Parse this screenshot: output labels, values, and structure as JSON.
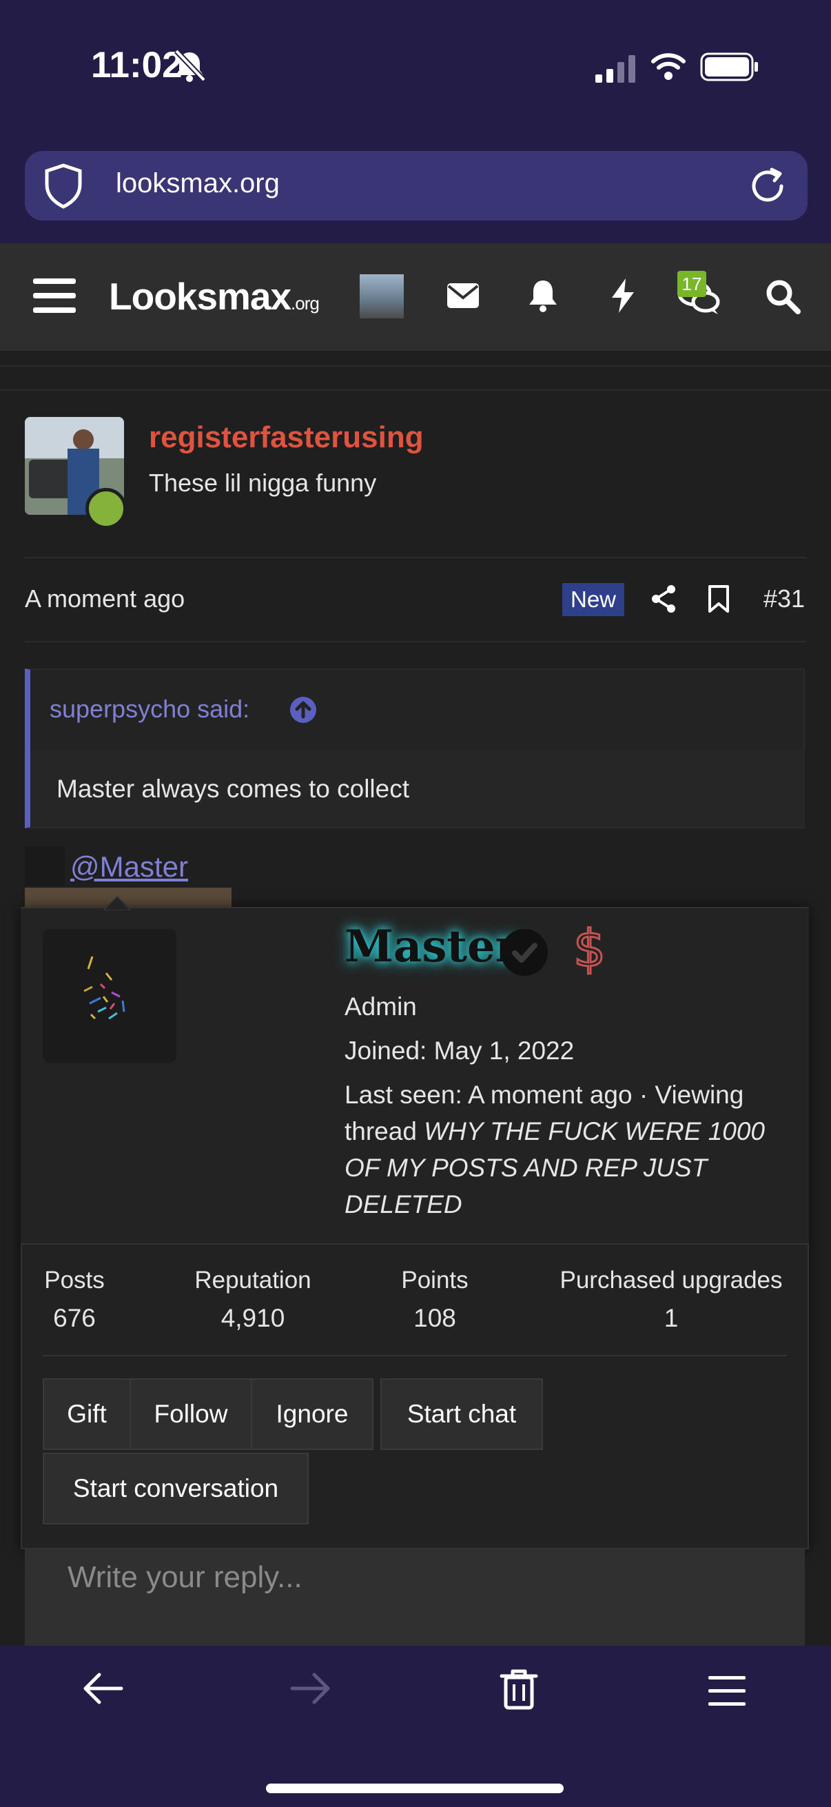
{
  "status_bar": {
    "time": "11:02"
  },
  "browser": {
    "url": "looksmax.org"
  },
  "forum_nav": {
    "logo_main": "Looksmax",
    "logo_suffix": ".org",
    "chat_badge_count": "17"
  },
  "post": {
    "username": "registerfasterusing",
    "user_title": "These lil nigga funny",
    "time": "A moment ago",
    "new_badge": "New",
    "post_number": "#31",
    "quote": {
      "author": "superpsycho said:",
      "text": "Master always comes to collect"
    },
    "mention": "@Master"
  },
  "member_card": {
    "name": "Master",
    "role": "Admin",
    "joined": "Joined: May 1, 2022",
    "last_seen_prefix": "Last seen: A moment ago · Viewing",
    "last_seen_line2_prefix": "thread ",
    "last_seen_line2_thread": "WHY THE FUCK WERE 1000",
    "last_seen_line3": "OF MY POSTS AND REP JUST",
    "last_seen_line4": "DELETED",
    "stats": [
      {
        "label": "Posts",
        "value": "676"
      },
      {
        "label": "Reputation",
        "value": "4,910"
      },
      {
        "label": "Points",
        "value": "108"
      },
      {
        "label": "Purchased upgrades",
        "value": "1"
      }
    ],
    "buttons": {
      "gift": "Gift",
      "follow": "Follow",
      "ignore": "Ignore",
      "start_chat": "Start chat",
      "start_conversation": "Start conversation"
    }
  },
  "reply": {
    "placeholder": "Write your reply..."
  },
  "colors": {
    "browser_chrome": "#231c47",
    "url_bar": "#3a3574",
    "username": "#e0533f",
    "link": "#7f80d6",
    "online": "#84b23b",
    "new_badge": "#2f3f8a"
  }
}
